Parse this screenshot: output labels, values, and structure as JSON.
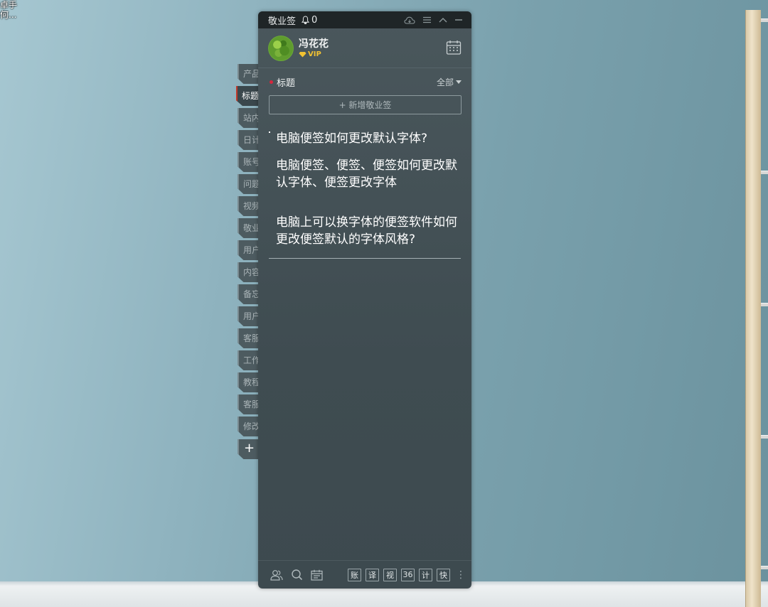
{
  "desktop": {
    "icon_label_line1": "卓手",
    "icon_label_line2": "何..."
  },
  "app": {
    "name": "敬业签",
    "notification_count": "0"
  },
  "user": {
    "name": "冯花花",
    "badge": "VIP"
  },
  "section": {
    "title": "标题",
    "filter": "全部"
  },
  "new_note_label": "+ 新增敬业签",
  "note": {
    "line1": "电脑便签如何更改默认字体?",
    "line2": "电脑便签、便签、便签如何更改默认字体、便签更改字体",
    "line3": "电脑上可以换字体的便签软件如何更改便签默认的字体风格?"
  },
  "side_tabs": [
    "产品",
    "标题",
    "站内",
    "日计",
    "账号",
    "问题",
    "视频",
    "敬业",
    "用户",
    "内容",
    "备忘",
    "用户",
    "客服",
    "工作",
    "教程",
    "客服",
    "修改"
  ],
  "side_tab_active_index": 1,
  "add_tab_label": "+",
  "bottom_tools": [
    "账",
    "译",
    "视",
    "36",
    "计",
    "快"
  ],
  "colors": {
    "accent_red": "#d7263d",
    "vip_gold": "#f1c232"
  }
}
